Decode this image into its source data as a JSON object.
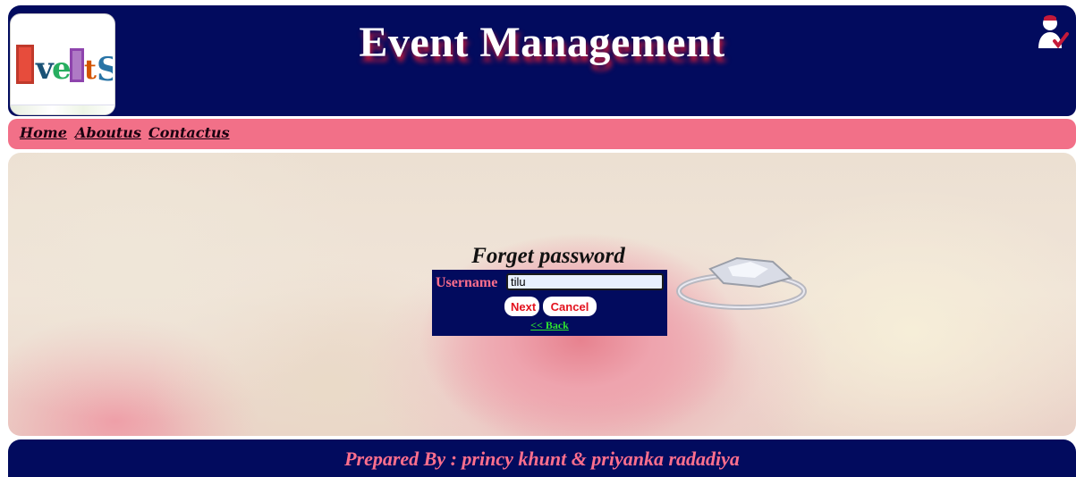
{
  "header": {
    "title": "Event Management",
    "logo_text": "EveNtS"
  },
  "nav": {
    "items": [
      {
        "label": "Home"
      },
      {
        "label": "Aboutus"
      },
      {
        "label": "Contactus"
      }
    ]
  },
  "form": {
    "title": "Forget password",
    "username_label": "Username",
    "username_value": "tilu",
    "next_label": "Next",
    "cancel_label": "Cancel",
    "back_label": "<< Back"
  },
  "footer": {
    "text": "Prepared By : princy khunt & priyanka radadiya"
  },
  "icons": {
    "user": "user-icon",
    "ring": "ring-image"
  },
  "colors": {
    "header_bg": "#020b5e",
    "nav_bg": "#f27088",
    "accent_pink": "#ff6f8d",
    "button_text": "#e3121e",
    "back_link": "#2ee62e"
  }
}
